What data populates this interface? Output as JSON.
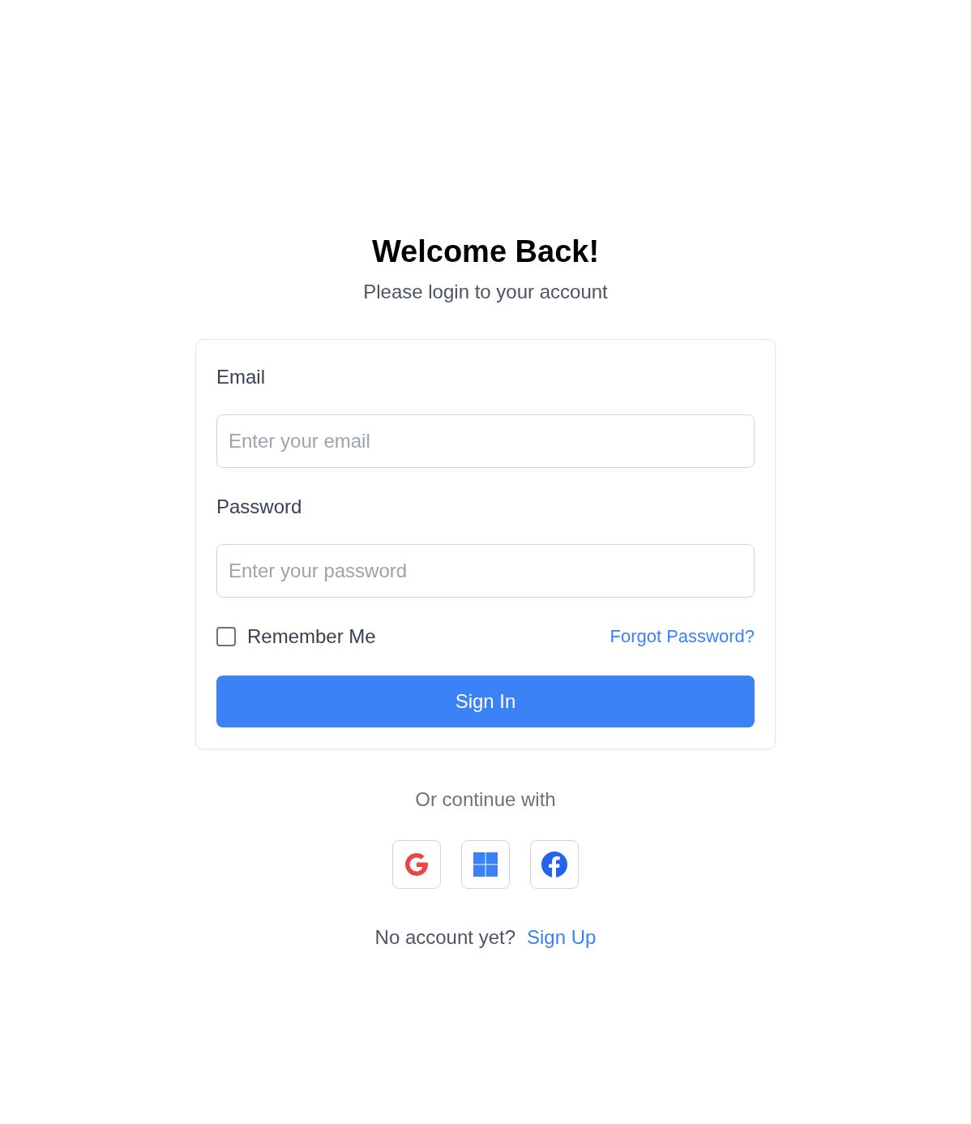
{
  "header": {
    "title": "Welcome Back!",
    "subtitle": "Please login to your account"
  },
  "form": {
    "fields": [
      {
        "label": "Email",
        "placeholder": "Enter your email"
      },
      {
        "label": "Password",
        "placeholder": "Enter your password"
      }
    ],
    "remember": {
      "label": "Remember Me",
      "checked": false
    },
    "forgot_link": "Forgot Password?",
    "submit": "Sign In"
  },
  "social": {
    "caption": "Or continue with",
    "providers": [
      {
        "kind": "google"
      },
      {
        "kind": "windows"
      },
      {
        "kind": "facebook"
      }
    ]
  },
  "footer": {
    "text": "No account yet?",
    "link": "Sign Up"
  }
}
